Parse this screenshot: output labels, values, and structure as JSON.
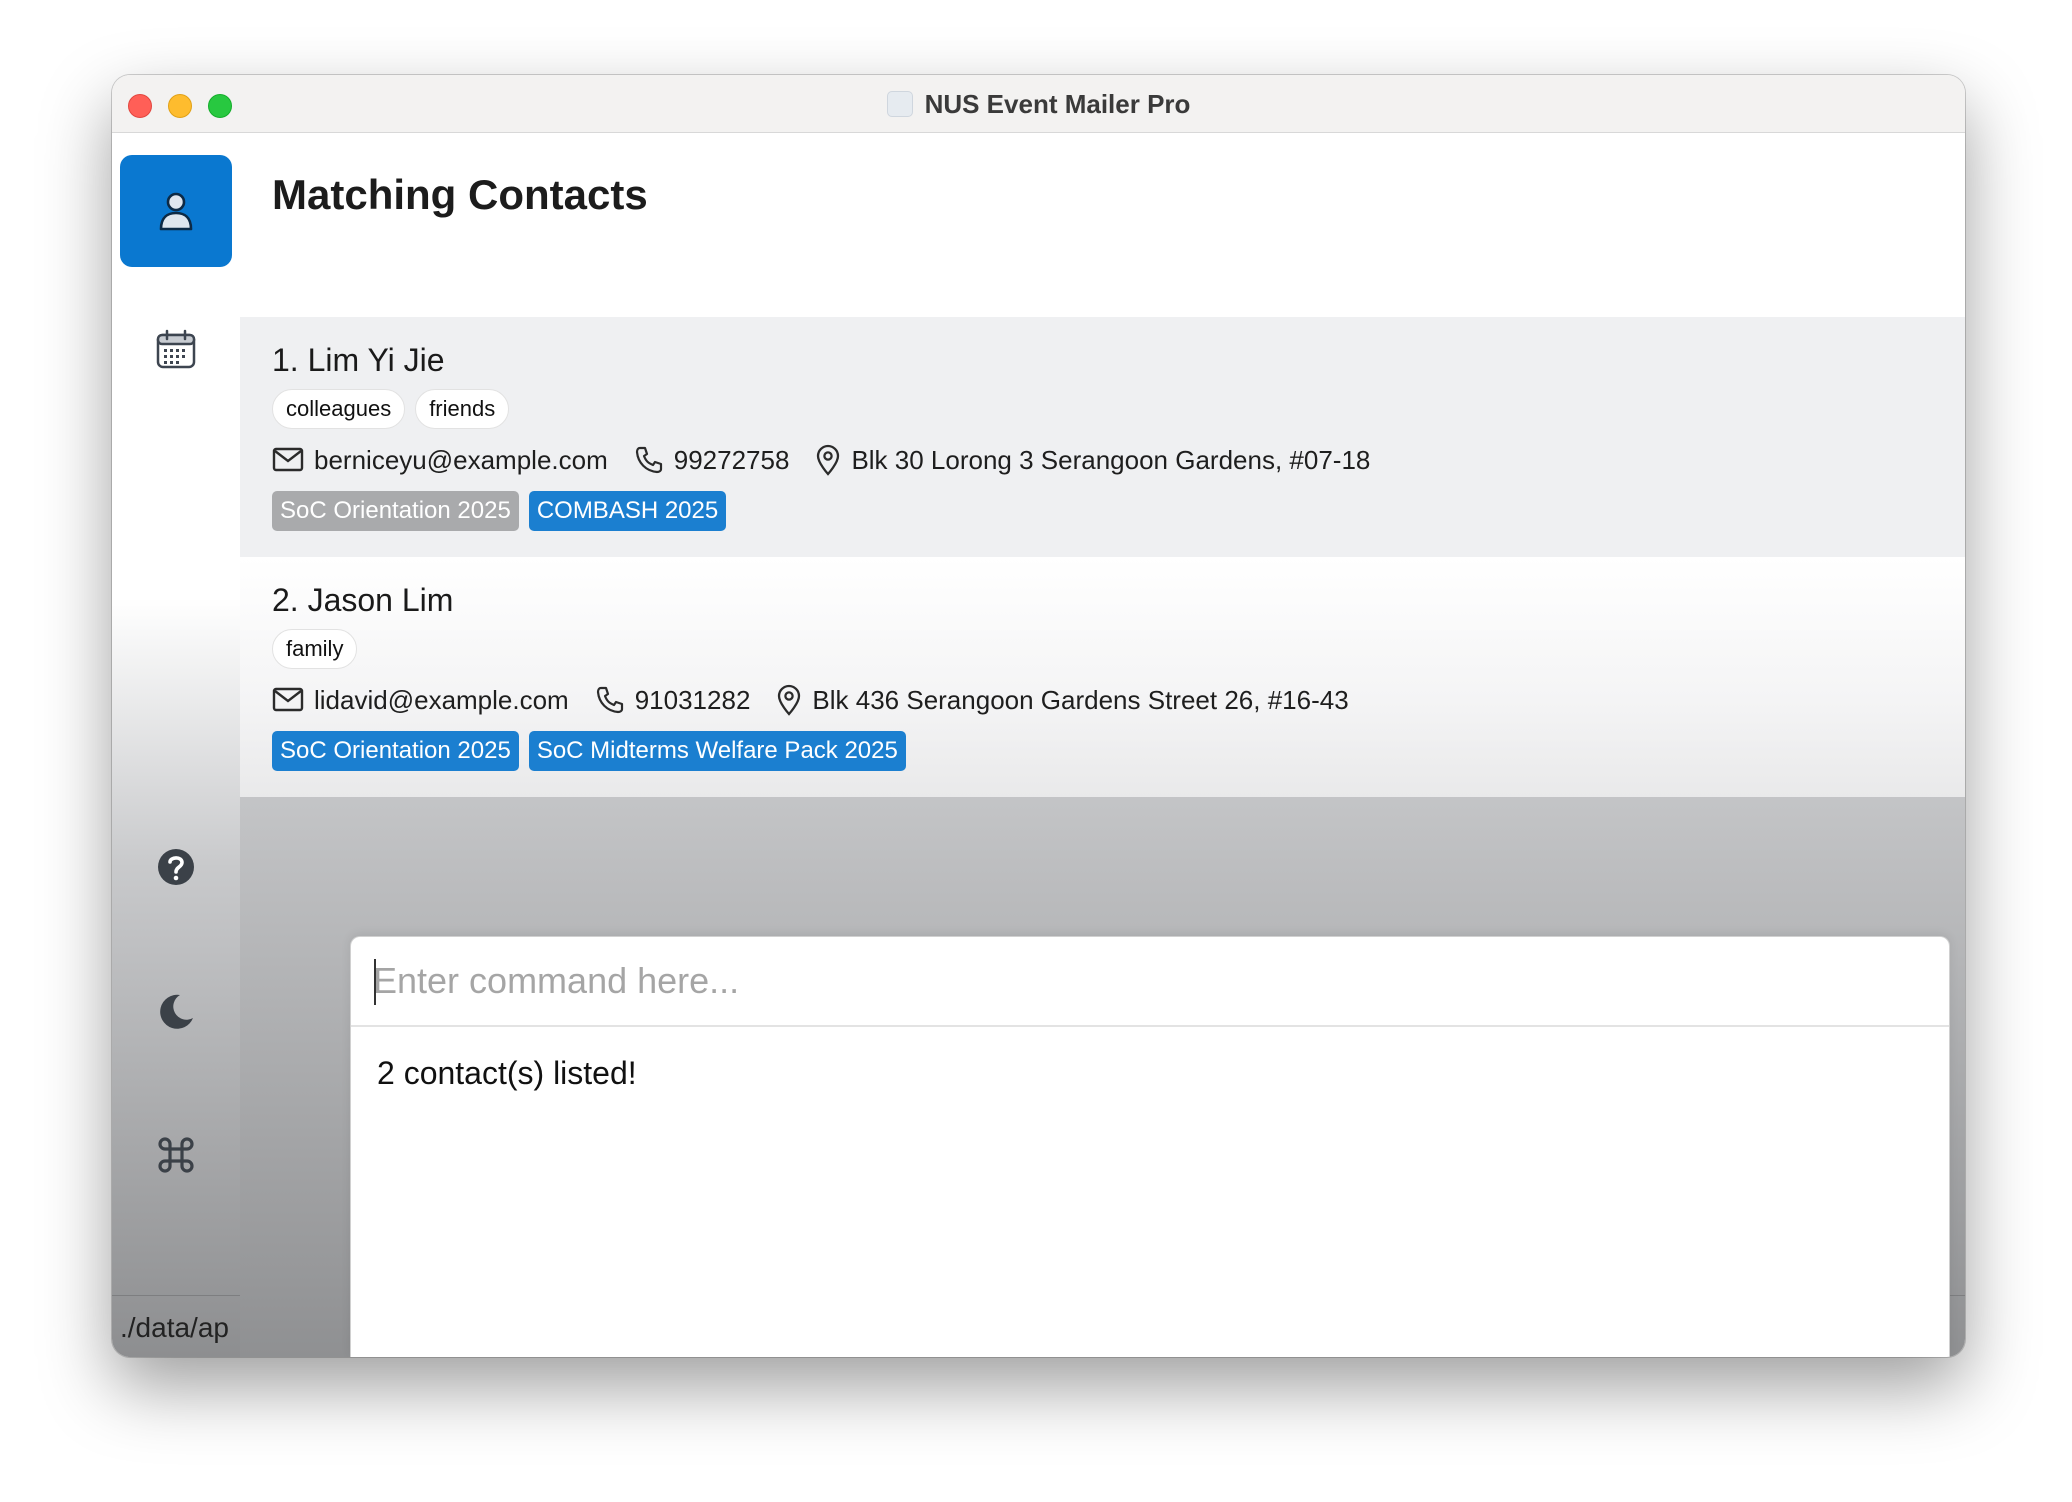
{
  "window": {
    "title": "NUS Event Mailer Pro"
  },
  "sidebar": {
    "items": [
      {
        "name": "contacts",
        "icon": "person-icon",
        "active": true
      },
      {
        "name": "events",
        "icon": "calendar-icon",
        "active": false
      },
      {
        "name": "help",
        "icon": "question-icon",
        "active": false
      },
      {
        "name": "theme",
        "icon": "moon-icon",
        "active": false
      },
      {
        "name": "commands",
        "icon": "command-icon",
        "active": false
      }
    ]
  },
  "main": {
    "title": "Matching Contacts",
    "contacts": [
      {
        "name": "1. Lim Yi Jie",
        "tags": [
          "colleagues",
          "friends"
        ],
        "email": "berniceyu@example.com",
        "phone": "99272758",
        "address": "Blk 30 Lorong 3 Serangoon Gardens, #07-18",
        "events": [
          {
            "label": "SoC Orientation 2025",
            "color": "#a9aaac"
          },
          {
            "label": "COMBASH 2025",
            "color": "#1b7fd0"
          }
        ]
      },
      {
        "name": "2. Jason Lim",
        "tags": [
          "family"
        ],
        "email": "lidavid@example.com",
        "phone": "91031282",
        "address": "Blk 436 Serangoon Gardens Street 26, #16-43",
        "events": [
          {
            "label": "SoC Orientation 2025",
            "color": "#1b7fd0"
          },
          {
            "label": "SoC Midterms Welfare Pack 2025",
            "color": "#1b7fd0"
          }
        ]
      }
    ]
  },
  "command": {
    "placeholder": "Enter command here...",
    "value": "",
    "result": "2 contact(s) listed!"
  },
  "status": {
    "path": "./data/ap"
  },
  "colors": {
    "accent": "#0a78d0",
    "event_blue": "#1b7fd0",
    "event_grey": "#a9aaac"
  }
}
